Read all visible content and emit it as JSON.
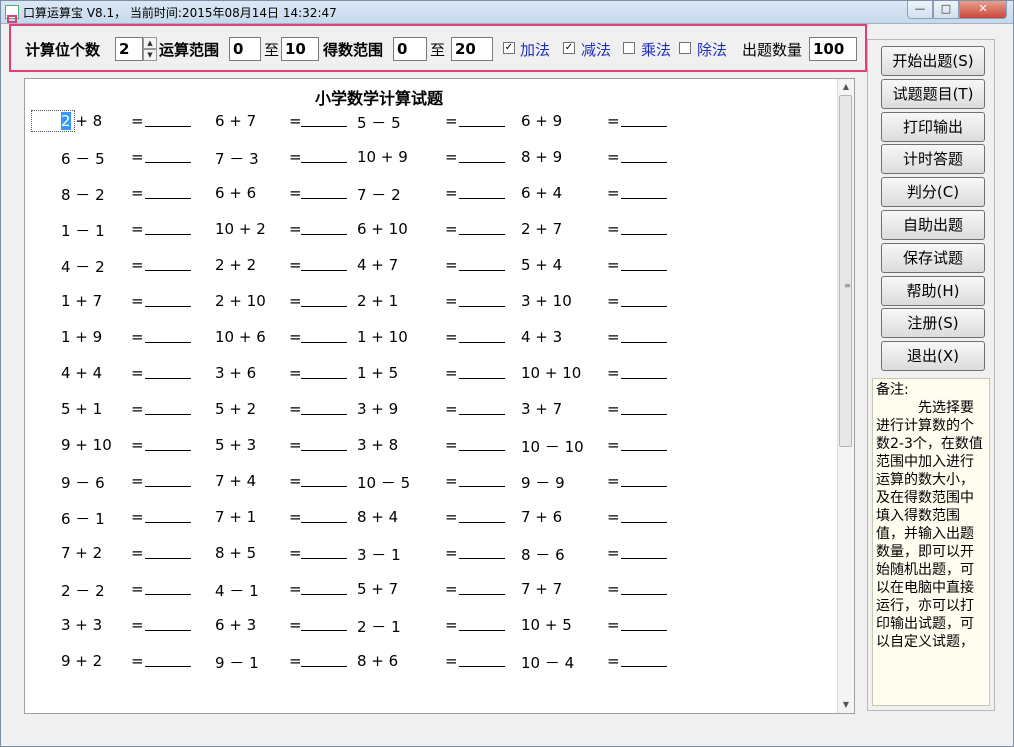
{
  "window": {
    "title": "口算运算宝 V8.1， 当前时间:2015年08月14日 14:32:47",
    "controls": {
      "minimize": "—",
      "maximize": "□",
      "close": "✕"
    }
  },
  "settings": {
    "digit_count_label": "计算位个数",
    "digit_count_value": "2",
    "range_label": "运算范围",
    "range_from": "0",
    "range_to_word": "至",
    "range_to": "10",
    "result_label": "得数范围",
    "result_from": "0",
    "result_to_word": "至",
    "result_to": "20",
    "ops": [
      {
        "label": "加法",
        "checked": true
      },
      {
        "label": "减法",
        "checked": true
      },
      {
        "label": "乘法",
        "checked": false
      },
      {
        "label": "除法",
        "checked": false
      }
    ],
    "count_label": "出题数量",
    "count_value": "100"
  },
  "sheet": {
    "title": "小学数学计算试题",
    "equals": "=",
    "rows": [
      [
        "2 + 8",
        "6 + 7",
        "5 － 5",
        "6 + 9"
      ],
      [
        "6 － 5",
        "7 － 3",
        "10 + 9",
        "8 + 9"
      ],
      [
        "8 － 2",
        "6 + 6",
        "7 － 2",
        "6 + 4"
      ],
      [
        "1 － 1",
        "10 + 2",
        "6 + 10",
        "2 + 7"
      ],
      [
        "4 － 2",
        "2 + 2",
        "4 + 7",
        "5 + 4"
      ],
      [
        "1 + 7",
        "2 + 10",
        "2 + 1",
        "3 + 10"
      ],
      [
        "1 + 9",
        "10 + 6",
        "1 + 10",
        "4 + 3"
      ],
      [
        "4 + 4",
        "3 + 6",
        "1 + 5",
        "10 + 10"
      ],
      [
        "5 + 1",
        "5 + 2",
        "3 + 9",
        "3 + 7"
      ],
      [
        "9 + 10",
        "5 + 3",
        "3 + 8",
        "10 － 10"
      ],
      [
        "9 － 6",
        "7 + 4",
        "10 － 5",
        "9 － 9"
      ],
      [
        "6 － 1",
        "7 + 1",
        "8 + 4",
        "7 + 6"
      ],
      [
        "7 + 2",
        "8 + 5",
        "3 － 1",
        "8 － 6"
      ],
      [
        "2 － 2",
        "4 － 1",
        "5 + 7",
        "7 + 7"
      ],
      [
        "3 + 3",
        "6 + 3",
        "2 － 1",
        "10 + 5"
      ],
      [
        "9 + 2",
        "9 － 1",
        "8 + 6",
        "10 － 4"
      ]
    ]
  },
  "buttons": [
    {
      "name": "start",
      "label": "开始出题(S)"
    },
    {
      "name": "answer-key",
      "label": "试题题目(T)"
    },
    {
      "name": "print",
      "label": "打印输出"
    },
    {
      "name": "timed",
      "label": "计时答题"
    },
    {
      "name": "grade",
      "label": "判分(C)"
    },
    {
      "name": "custom",
      "label": "自助出题"
    },
    {
      "name": "save",
      "label": "保存试题"
    },
    {
      "name": "help",
      "label": "帮助(H)"
    },
    {
      "name": "register",
      "label": "注册(S)"
    },
    {
      "name": "exit",
      "label": "退出(X)"
    }
  ],
  "note": {
    "heading": "备注:",
    "text": "先选择要进行计算数的个数2-3个，在数值范围中加入进行运算的数大小，及在得数范围中填入得数范围值，并输入出题数量，即可以开始随机出题，可以在电脑中直接运行，亦可以打印输出试题，可以自定义试题，"
  }
}
